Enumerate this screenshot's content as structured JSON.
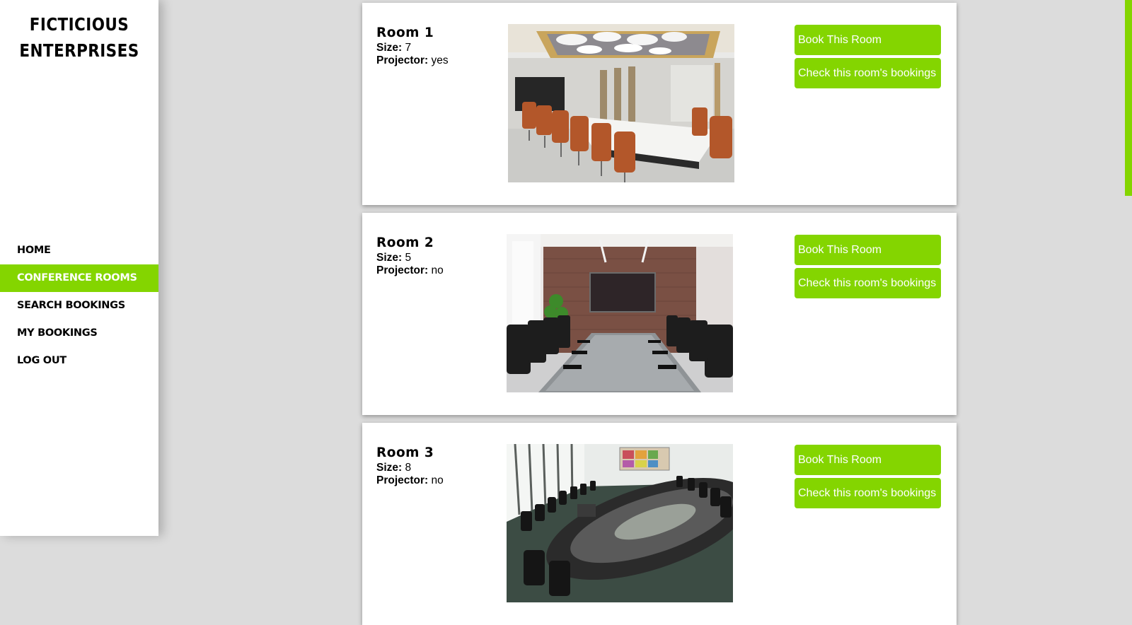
{
  "brand": {
    "line1": "FICTICIOUS",
    "line2": "ENTERPRISES"
  },
  "nav": {
    "items": [
      {
        "label": "HOME"
      },
      {
        "label": "CONFERENCE ROOMS"
      },
      {
        "label": "SEARCH BOOKINGS"
      },
      {
        "label": "MY BOOKINGS"
      },
      {
        "label": "LOG OUT"
      }
    ],
    "active": "CONFERENCE ROOMS"
  },
  "labels": {
    "size": "Size:",
    "projector": "Projector:",
    "book_button": "Book This Room",
    "check_button": "Check this room's bookings"
  },
  "rooms": [
    {
      "name": "Room 1",
      "size": "7",
      "projector": "yes"
    },
    {
      "name": "Room 2",
      "size": "5",
      "projector": "no"
    },
    {
      "name": "Room 3",
      "size": "8",
      "projector": "no"
    }
  ],
  "colors": {
    "accent": "#84d500",
    "background": "#dcdcdc",
    "card": "#ffffff"
  }
}
